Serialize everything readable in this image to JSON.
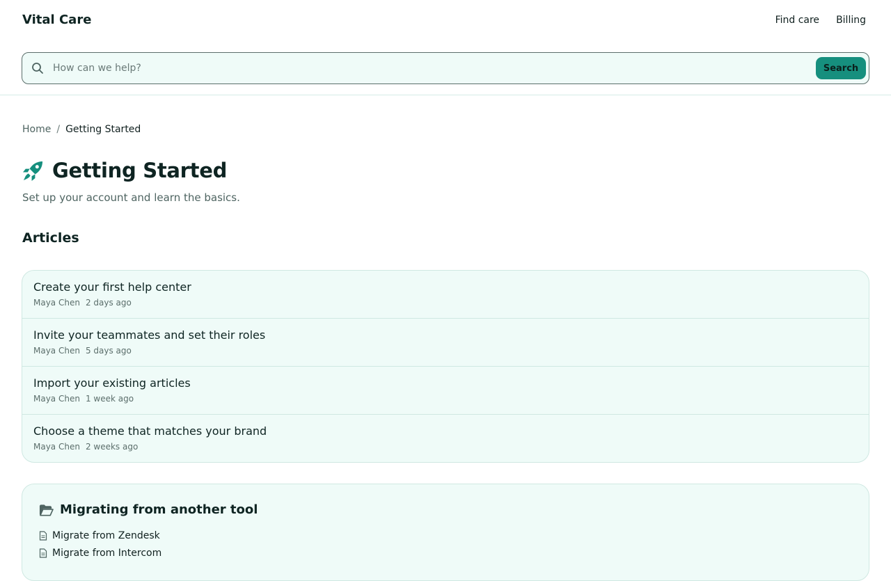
{
  "brand": {
    "name": "Vital Care"
  },
  "nav": {
    "items": [
      {
        "label": "Find care"
      },
      {
        "label": "Billing"
      }
    ]
  },
  "search": {
    "placeholder": "How can we help?",
    "button_label": "Search"
  },
  "breadcrumb": {
    "home": "Home",
    "separator": "/",
    "current": "Getting Started"
  },
  "page": {
    "title": "Getting Started",
    "subtitle": "Set up your account and learn the basics.",
    "icon": "rocket-icon"
  },
  "articles": {
    "heading": "Articles",
    "items": [
      {
        "title": "Create your first help center",
        "author": "Maya Chen",
        "time": "2 days ago"
      },
      {
        "title": "Invite your teammates and set their roles",
        "author": "Maya Chen",
        "time": "5 days ago"
      },
      {
        "title": "Import your existing articles",
        "author": "Maya Chen",
        "time": "1 week ago"
      },
      {
        "title": "Choose a theme that matches your brand",
        "author": "Maya Chen",
        "time": "2 weeks ago"
      }
    ]
  },
  "collection": {
    "title": "Migrating from another tool",
    "icon": "folder-open-icon",
    "items": [
      {
        "label": "Migrate from Zendesk"
      },
      {
        "label": "Migrate from Intercom"
      }
    ]
  },
  "colors": {
    "accent": "#168f7e",
    "card_bg": "#effbf8",
    "border": "#cfe8e2",
    "text": "#0e2422",
    "muted": "#5b6e6b"
  }
}
